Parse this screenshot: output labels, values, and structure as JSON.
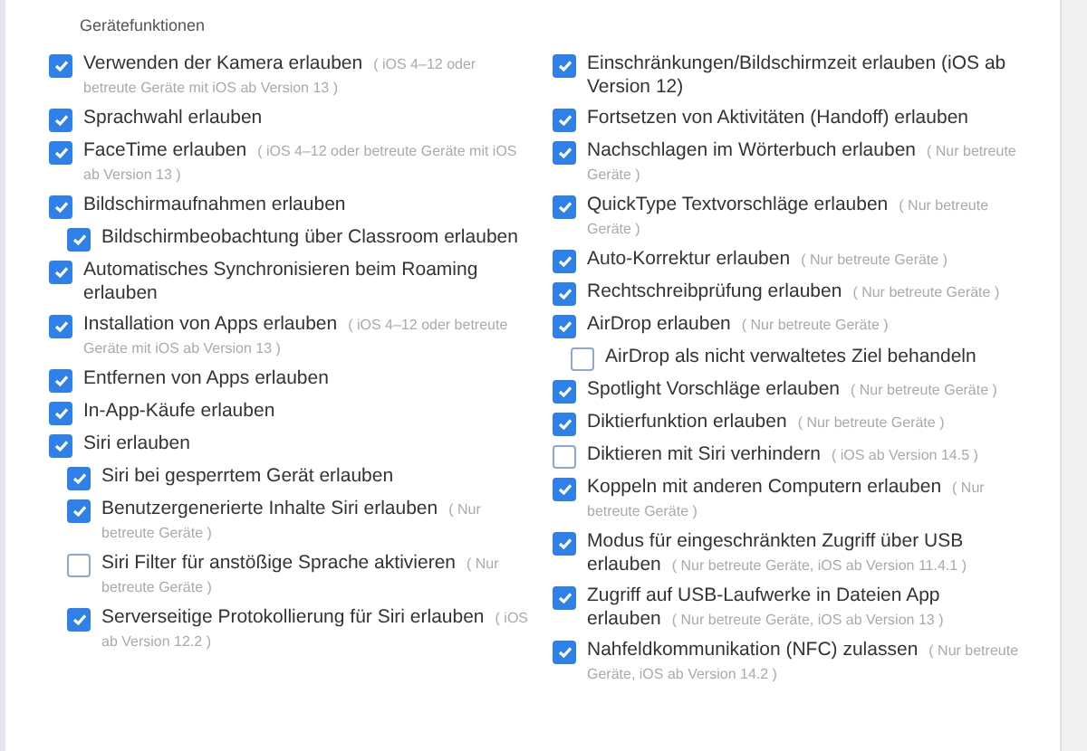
{
  "section_title": "Gerätefunktionen",
  "columns": [
    [
      {
        "label": "Verwenden der Kamera erlauben",
        "hint": "( iOS 4–12 oder betreute Geräte mit iOS ab Version 13 )",
        "checked": true
      },
      {
        "label": "Sprachwahl erlauben",
        "checked": true
      },
      {
        "label": "FaceTime erlauben",
        "hint": "( iOS 4–12 oder betreute Geräte mit iOS ab Version 13 )",
        "checked": true
      },
      {
        "label": "Bildschirmaufnahmen erlauben",
        "checked": true,
        "children": [
          {
            "label": "Bildschirmbeobachtung über Classroom erlauben",
            "checked": true
          }
        ]
      },
      {
        "label": "Automatisches Synchronisieren beim Roaming erlauben",
        "checked": true
      },
      {
        "label": "Installation von Apps erlauben",
        "hint": "( iOS 4–12 oder betreute Geräte mit iOS ab Version 13 )",
        "checked": true
      },
      {
        "label": "Entfernen von Apps erlauben",
        "checked": true
      },
      {
        "label": "In-App-Käufe erlauben",
        "checked": true
      },
      {
        "label": "Siri erlauben",
        "checked": true,
        "children": [
          {
            "label": "Siri bei gesperrtem Gerät erlauben",
            "checked": true
          },
          {
            "label": "Benutzergenerierte Inhalte Siri erlauben",
            "hint": "( Nur betreute Geräte )",
            "checked": true
          },
          {
            "label": "Siri Filter für anstößige Sprache aktivieren",
            "hint": "( Nur betreute Geräte )",
            "checked": false
          },
          {
            "label": "Serverseitige Protokollierung für Siri erlauben",
            "hint": "( iOS ab Version 12.2 )",
            "checked": true
          }
        ]
      }
    ],
    [
      {
        "label": "Einschränkungen/Bildschirmzeit erlauben (iOS ab Version 12)",
        "checked": true
      },
      {
        "label": "Fortsetzen von Aktivitäten (Handoff) erlauben",
        "checked": true
      },
      {
        "label": "Nachschlagen im Wörterbuch erlauben",
        "hint": "( Nur betreute Geräte )",
        "checked": true
      },
      {
        "label": "QuickType Textvorschläge erlauben",
        "hint": "( Nur betreute Geräte )",
        "checked": true
      },
      {
        "label": "Auto-Korrektur erlauben",
        "hint": "( Nur betreute Geräte )",
        "checked": true
      },
      {
        "label": "Rechtschreibprüfung erlauben",
        "hint": "( Nur betreute Geräte )",
        "checked": true
      },
      {
        "label": "AirDrop erlauben",
        "hint": "( Nur betreute Geräte )",
        "checked": true,
        "children": [
          {
            "label": "AirDrop als nicht verwaltetes Ziel behandeln",
            "checked": false
          }
        ]
      },
      {
        "label": "Spotlight Vorschläge erlauben",
        "hint": "( Nur betreute Geräte )",
        "checked": true
      },
      {
        "label": "Diktierfunktion erlauben",
        "hint": "( Nur betreute Geräte )",
        "checked": true
      },
      {
        "label": "Diktieren mit Siri verhindern",
        "hint": "( iOS ab Version 14.5 )",
        "checked": false
      },
      {
        "label": "Koppeln mit anderen Computern erlauben",
        "hint": "( Nur betreute Geräte )",
        "checked": true
      },
      {
        "label": "Modus für eingeschränkten Zugriff über USB erlauben",
        "hint": "( Nur betreute Geräte, iOS ab Version 11.4.1 )",
        "checked": true
      },
      {
        "label": "Zugriff auf USB-Laufwerke in Dateien App erlauben",
        "hint": "( Nur betreute Geräte, iOS ab Version 13 )",
        "checked": true
      },
      {
        "label": "Nahfeldkommunikation (NFC) zulassen",
        "hint": "( Nur betreute Geräte, iOS ab Version 14.2 )",
        "checked": true
      }
    ]
  ]
}
